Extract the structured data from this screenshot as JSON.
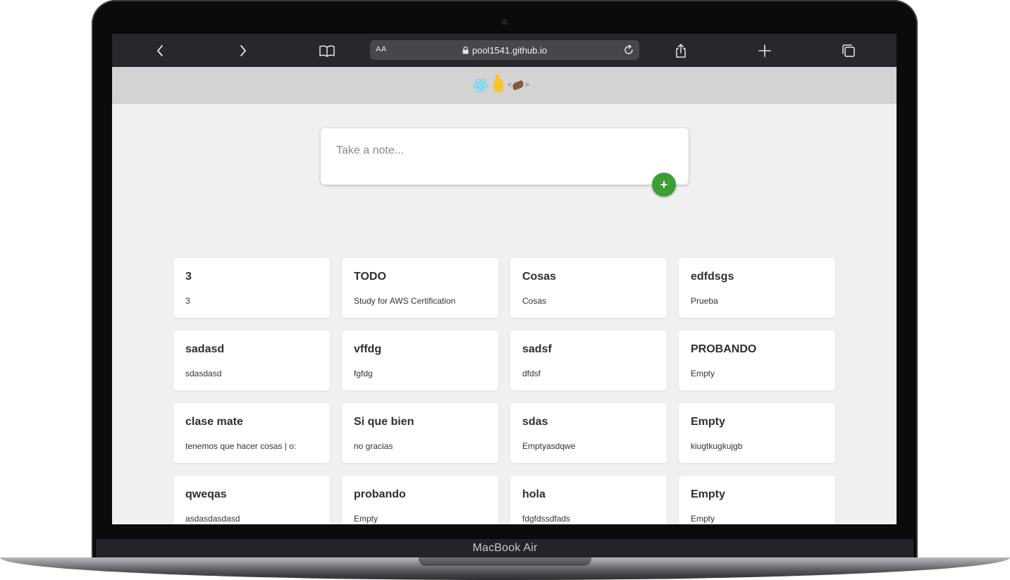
{
  "browser": {
    "url": "pool1541.github.io",
    "text_size_label": "AA",
    "icons": {
      "back": "chevron-left-icon",
      "forward": "chevron-right-icon",
      "bookmarks": "book-icon",
      "share": "share-icon",
      "new_tab": "plus-icon",
      "tabs": "tabs-icon",
      "reload": "reload-icon",
      "lock": "lock-icon"
    }
  },
  "app": {
    "composer": {
      "placeholder": "Take a note...",
      "add_label": "+"
    },
    "accent_color": "#3d9e36",
    "notes": [
      {
        "title": "3",
        "content": "3"
      },
      {
        "title": "TODO",
        "content": "Study for AWS Certification"
      },
      {
        "title": "Cosas",
        "content": "Cosas"
      },
      {
        "title": "edfdsgs",
        "content": "Prueba"
      },
      {
        "title": "sadasd",
        "content": "sdasdasd"
      },
      {
        "title": "vffdg",
        "content": "fgfdg"
      },
      {
        "title": "sadsf",
        "content": "dfdsf"
      },
      {
        "title": "PROBANDO",
        "content": "Empty"
      },
      {
        "title": "clase mate",
        "content": "tenemos que hacer cosas | o:"
      },
      {
        "title": "Si que bien",
        "content": "no gracias"
      },
      {
        "title": "sdas",
        "content": "Emptyasdqwe"
      },
      {
        "title": "Empty",
        "content": "kiugtkugkujgb"
      },
      {
        "title": "qweqas",
        "content": "asdasdasdasd"
      },
      {
        "title": "probando",
        "content": "Empty"
      },
      {
        "title": "hola",
        "content": "fdgfdssdfads"
      },
      {
        "title": "Empty",
        "content": "Empty"
      }
    ]
  },
  "device": {
    "label": "MacBook Air"
  }
}
